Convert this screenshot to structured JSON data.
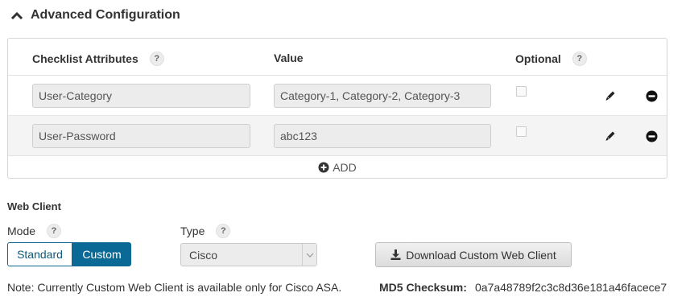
{
  "advanced": {
    "title": "Advanced Configuration",
    "table": {
      "headers": {
        "attribute": "Checklist Attributes",
        "value": "Value",
        "optional": "Optional"
      },
      "help_glyph": "?",
      "rows": [
        {
          "attribute": "User-Category",
          "value": "Category-1, Category-2, Category-3",
          "optional": false
        },
        {
          "attribute": "User-Password",
          "value": "abc123",
          "optional": false
        }
      ],
      "add_label": "ADD"
    }
  },
  "web_client": {
    "title": "Web Client",
    "mode_label": "Mode",
    "mode_options": [
      "Standard",
      "Custom"
    ],
    "mode_selected": "Custom",
    "type_label": "Type",
    "type_value": "Cisco",
    "download_label": "Download Custom Web Client",
    "note": "Note: Currently Custom Web Client is available only for Cisco ASA.",
    "md5_label": "MD5 Checksum:",
    "md5_value": "0a7a48789f2c3c8d36e181a46facece7"
  },
  "colors": {
    "accent": "#0a6a95",
    "panel_border": "#d6d6d6"
  },
  "icons": {
    "collapse": "chevron-up-icon",
    "help": "help-icon",
    "edit": "pencil-icon",
    "remove": "minus-circle-icon",
    "add": "plus-circle-icon",
    "download": "download-icon",
    "dropdown": "caret-down-icon"
  }
}
